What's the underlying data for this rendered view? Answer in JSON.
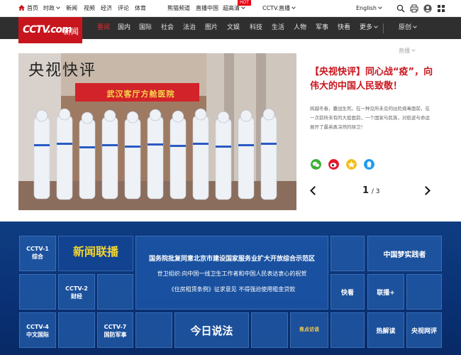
{
  "topbar": {
    "home": "首页",
    "politics": "时政",
    "items": [
      "新闻",
      "视频",
      "经济",
      "评论",
      "体育",
      "熊猫频道",
      "直播中国",
      "超高清"
    ],
    "hot_badge": "HOT",
    "cctv_live": "CCTV.直播",
    "language": "English"
  },
  "logo": {
    "brand": "CCTV.com",
    "sub": "新闻"
  },
  "nav": {
    "items": [
      "要闻",
      "国内",
      "国际",
      "社会",
      "法治",
      "图片",
      "文娱",
      "科技",
      "生活",
      "人物",
      "军事",
      "快看"
    ],
    "more": "更多",
    "original": "原创",
    "live_dropdown": "直播"
  },
  "hero": {
    "image_caption_art": "央视快评",
    "image_sign": "武汉客厅方舱医院",
    "title": "【央视快评】同心战“疫”，向伟大的中国人民致敬！",
    "description": "跨越冬春，鏖战生死。在一种见所未见的凶险病毒面前，在一次前所未有的大疫面前，一个国家与民族，对航迹与命运展开了最英勇决然的捍卫！",
    "pager": {
      "current": "1",
      "total": "/ 3"
    },
    "share_icons": [
      "wechat-icon",
      "weibo-icon",
      "qzone-icon",
      "qq-icon"
    ]
  },
  "live": {
    "tiles": {
      "cctv1": "CCTV-1\n综合",
      "cctv2": "CCTV-2\n财经",
      "cctv4": "CCTV-4\n中文国际",
      "cctv7": "CCTV-7\n国防军事",
      "xwlb": "新闻联播",
      "zgm": "中国梦实践者",
      "kuaikan": "快看",
      "lianbo": "联播+",
      "rpyl": "热解读",
      "ysp": "央视网评",
      "jrsf": "今日说法",
      "jdsm": "焦点访谈"
    },
    "headlines": [
      "国务院批复同意北京市建设国家服务业扩大开放综合示范区",
      "世卫组织:向中国一线卫生工作者和中国人民表达衷心的祝贺",
      "《住房租赁条例》征求意见 不得强迫使用租金贷款"
    ]
  },
  "colors": {
    "brand_red": "#c8151d",
    "nav_bg": "#2f2f2f",
    "live_bg": "#0f3d82"
  }
}
